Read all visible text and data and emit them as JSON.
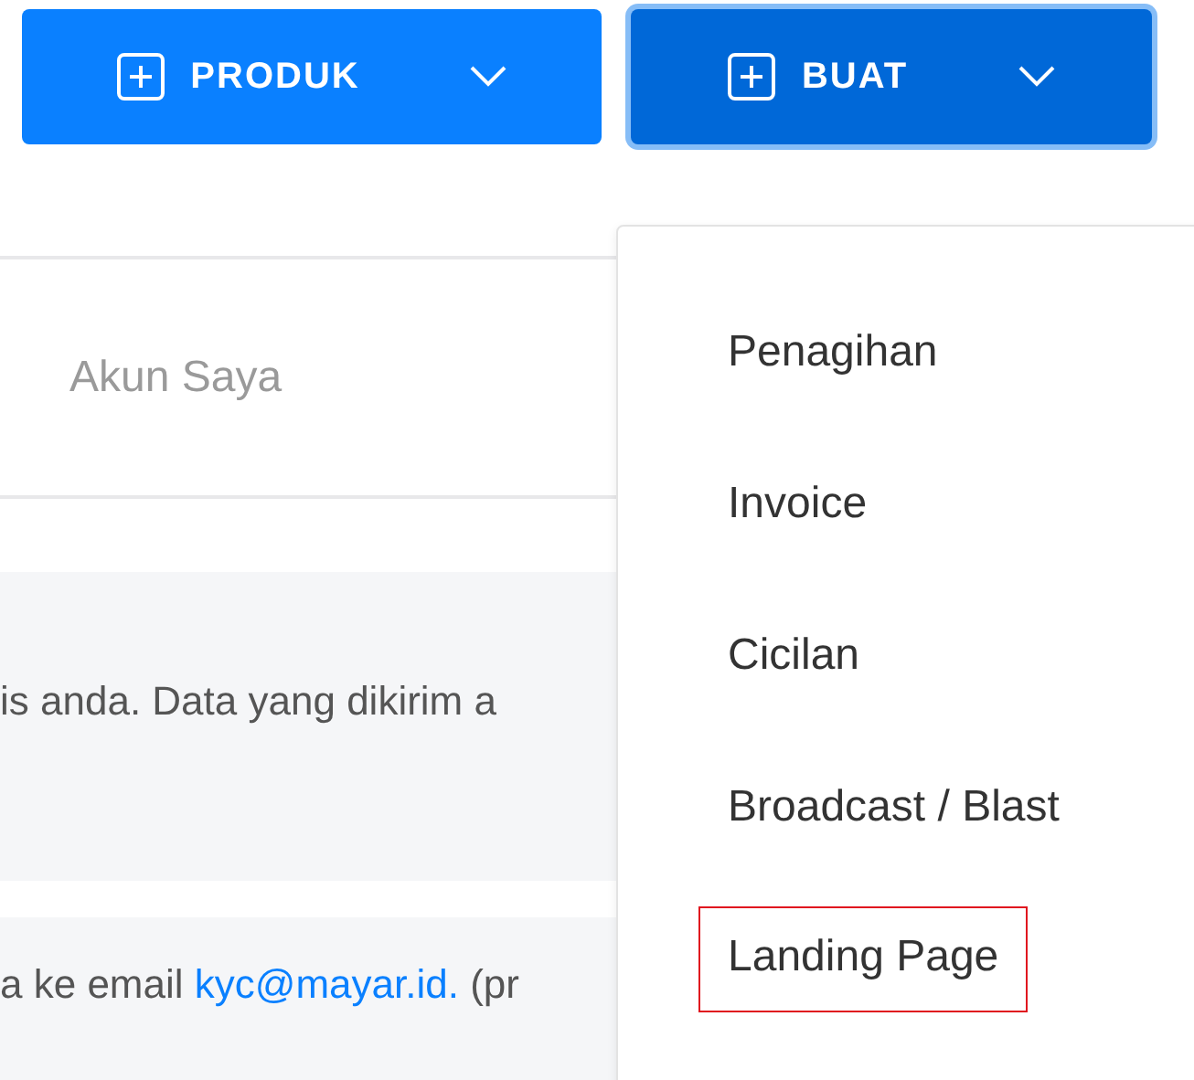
{
  "buttons": [
    {
      "label": "PRODUK",
      "focused": false
    },
    {
      "label": "BUAT",
      "focused": true
    }
  ],
  "tabs": [
    {
      "label": "Akun Saya",
      "selected": false
    }
  ],
  "notices": [
    {
      "text": "is anda. Data yang dikirim a"
    },
    {
      "text": "a ke email ",
      "link": "kyc@mayar.id.",
      "after": " (pr"
    }
  ],
  "menu": {
    "items": [
      {
        "label": "Penagihan",
        "highlighted": false
      },
      {
        "label": "Invoice",
        "highlighted": false
      },
      {
        "label": "Cicilan",
        "highlighted": false
      },
      {
        "label": "Broadcast / Blast",
        "highlighted": false
      },
      {
        "label": "Landing Page",
        "highlighted": true
      }
    ]
  }
}
